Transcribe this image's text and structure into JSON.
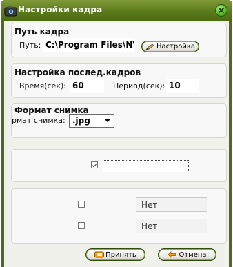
{
  "window": {
    "title": "Настройки кадра"
  },
  "path_group": {
    "title": "Путь кадра",
    "path_label": "Путь:",
    "path_value": "C:\\Program Files\\NVM",
    "settings_button": "Настройка"
  },
  "sequence_group": {
    "title": "Настройка послед.кадров",
    "time_label": "Время(сек):",
    "time_value": "60",
    "period_label": "Период(сек):",
    "period_value": "10"
  },
  "format_group": {
    "title": "Формат снимка",
    "format_label": "рмат снимка:",
    "format_value": ".jpg"
  },
  "option_group": {
    "checkbox_checked": true
  },
  "extra_group": {
    "row1_value": "Нет",
    "row2_value": "Нет"
  },
  "buttons": {
    "accept": "Принять",
    "cancel": "Отмена"
  },
  "colors": {
    "titlebar": "#5c7b1c",
    "frame": "#4f6a1c",
    "client": "#f1f1ec"
  }
}
